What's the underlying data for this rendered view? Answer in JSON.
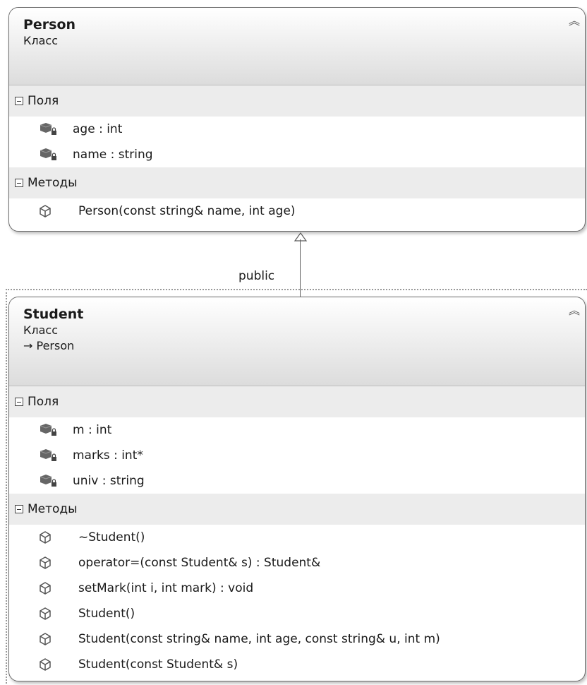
{
  "classes": {
    "person": {
      "name": "Person",
      "kind": "Класс",
      "sections": {
        "fields": {
          "label": "Поля",
          "items": [
            "age : int",
            "name : string"
          ]
        },
        "methods": {
          "label": "Методы",
          "items": [
            "Person(const string& name, int age)"
          ]
        }
      }
    },
    "student": {
      "name": "Student",
      "kind": "Класс",
      "base": "→ Person",
      "sections": {
        "fields": {
          "label": "Поля",
          "items": [
            "m : int",
            "marks : int*",
            "univ : string"
          ]
        },
        "methods": {
          "label": "Методы",
          "items": [
            "~Student()",
            "operator=(const Student& s) : Student&",
            "setMark(int i, int mark) : void",
            "Student()",
            "Student(const string& name, int age, const string& u, int m)",
            "Student(const Student& s)"
          ]
        }
      }
    }
  },
  "relation": {
    "label": "public"
  },
  "icons": {
    "collapse": "double-chevron-up-icon",
    "section_toggle": "minus-box-icon",
    "field": "private-field-icon",
    "method": "method-cube-icon"
  }
}
